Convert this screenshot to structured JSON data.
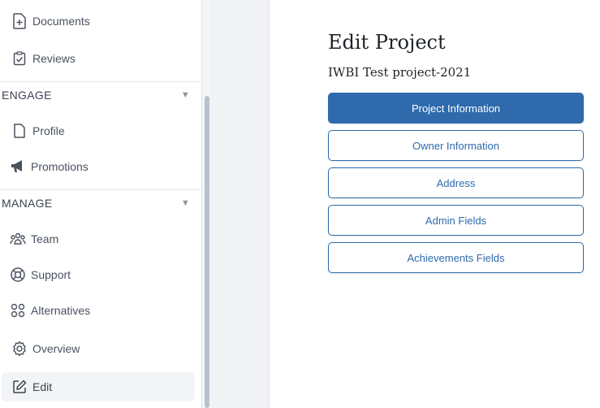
{
  "sidebar": {
    "items_top": [
      {
        "label": "Documents",
        "icon": "document-add-icon"
      },
      {
        "label": "Reviews",
        "icon": "clipboard-check-icon"
      }
    ],
    "engage": {
      "header": "ENGAGE",
      "items": [
        {
          "label": "Profile",
          "icon": "file-icon"
        },
        {
          "label": "Promotions",
          "icon": "megaphone-icon"
        }
      ]
    },
    "manage": {
      "header": "MANAGE",
      "items": [
        {
          "label": "Team",
          "icon": "team-icon"
        },
        {
          "label": "Support",
          "icon": "lifebuoy-icon"
        },
        {
          "label": "Alternatives",
          "icon": "grid-icon"
        },
        {
          "label": "Overview",
          "icon": "gear-icon"
        },
        {
          "label": "Edit",
          "icon": "edit-icon"
        }
      ]
    },
    "caret": "▼"
  },
  "main": {
    "title": "Edit Project",
    "project_name": "IWBI Test project-2021",
    "buttons": [
      {
        "label": "Project Information"
      },
      {
        "label": "Owner Information"
      },
      {
        "label": "Address"
      },
      {
        "label": "Admin Fields"
      },
      {
        "label": "Achievements Fields"
      }
    ]
  },
  "colors": {
    "accent": "#2f6aad",
    "text": "#1e2328",
    "nav_text": "#4a5260"
  }
}
